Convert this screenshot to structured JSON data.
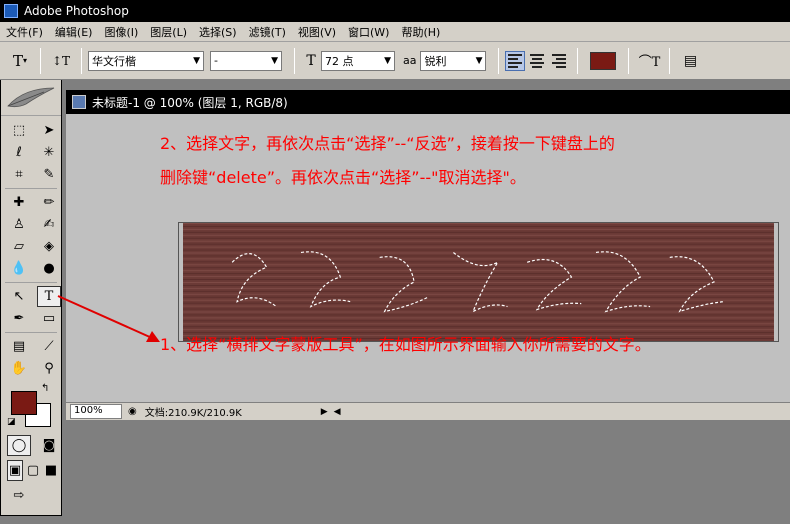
{
  "titlebar": {
    "title": "Adobe Photoshop"
  },
  "menubar": {
    "items": [
      "文件(F)",
      "编辑(E)",
      "图像(I)",
      "图层(L)",
      "选择(S)",
      "滤镜(T)",
      "视图(V)",
      "窗口(W)",
      "帮助(H)"
    ]
  },
  "options": {
    "font_family": "华文行楷",
    "font_style": "-",
    "font_size": "72 点",
    "antialias_label": "aa",
    "antialias": "锐利",
    "text_color": "#7a1a14"
  },
  "document": {
    "title": "未标题-1 @ 100% (图层 1, RGB/8)",
    "zoom": "100%",
    "doc_info": "文档:210.9K/210.9K"
  },
  "instructions": {
    "step2_line1": "2、选择文字，再依次点击“选择”--“反选”，接着按一下键盘上的",
    "step2_line2": "删除键“delete”。再依次点击“选择”--\"取消选择\"。",
    "step1": "1、选择“横排文字蒙版工具”，在如图所示界面输入你所需要的文字。"
  },
  "toolbox": {
    "foreground_color": "#7a1a14",
    "background_color": "#ffffff"
  },
  "colors": {
    "accent": "#ff0000",
    "wood": "#6b3a36"
  }
}
